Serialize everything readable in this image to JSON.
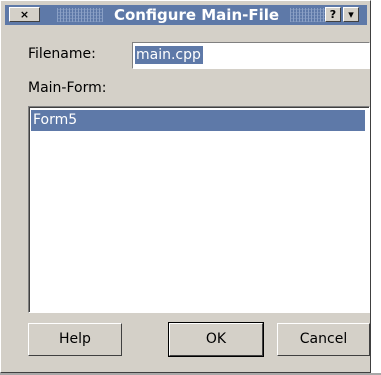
{
  "window": {
    "title": "Configure Main-File",
    "close_button": "×",
    "help_button": "?",
    "menu_button": "▾"
  },
  "form": {
    "filename_label": "Filename:",
    "filename_value": "main.cpp",
    "mainform_label": "Main-Form:",
    "forms": [
      {
        "label": "Form5",
        "selected": true
      }
    ]
  },
  "buttons": {
    "help": "Help",
    "ok": "OK",
    "cancel": "Cancel"
  },
  "colors": {
    "titlebar": "#5e79a8",
    "selection": "#5e79a8",
    "dialog_bg": "#d4d0c8"
  }
}
